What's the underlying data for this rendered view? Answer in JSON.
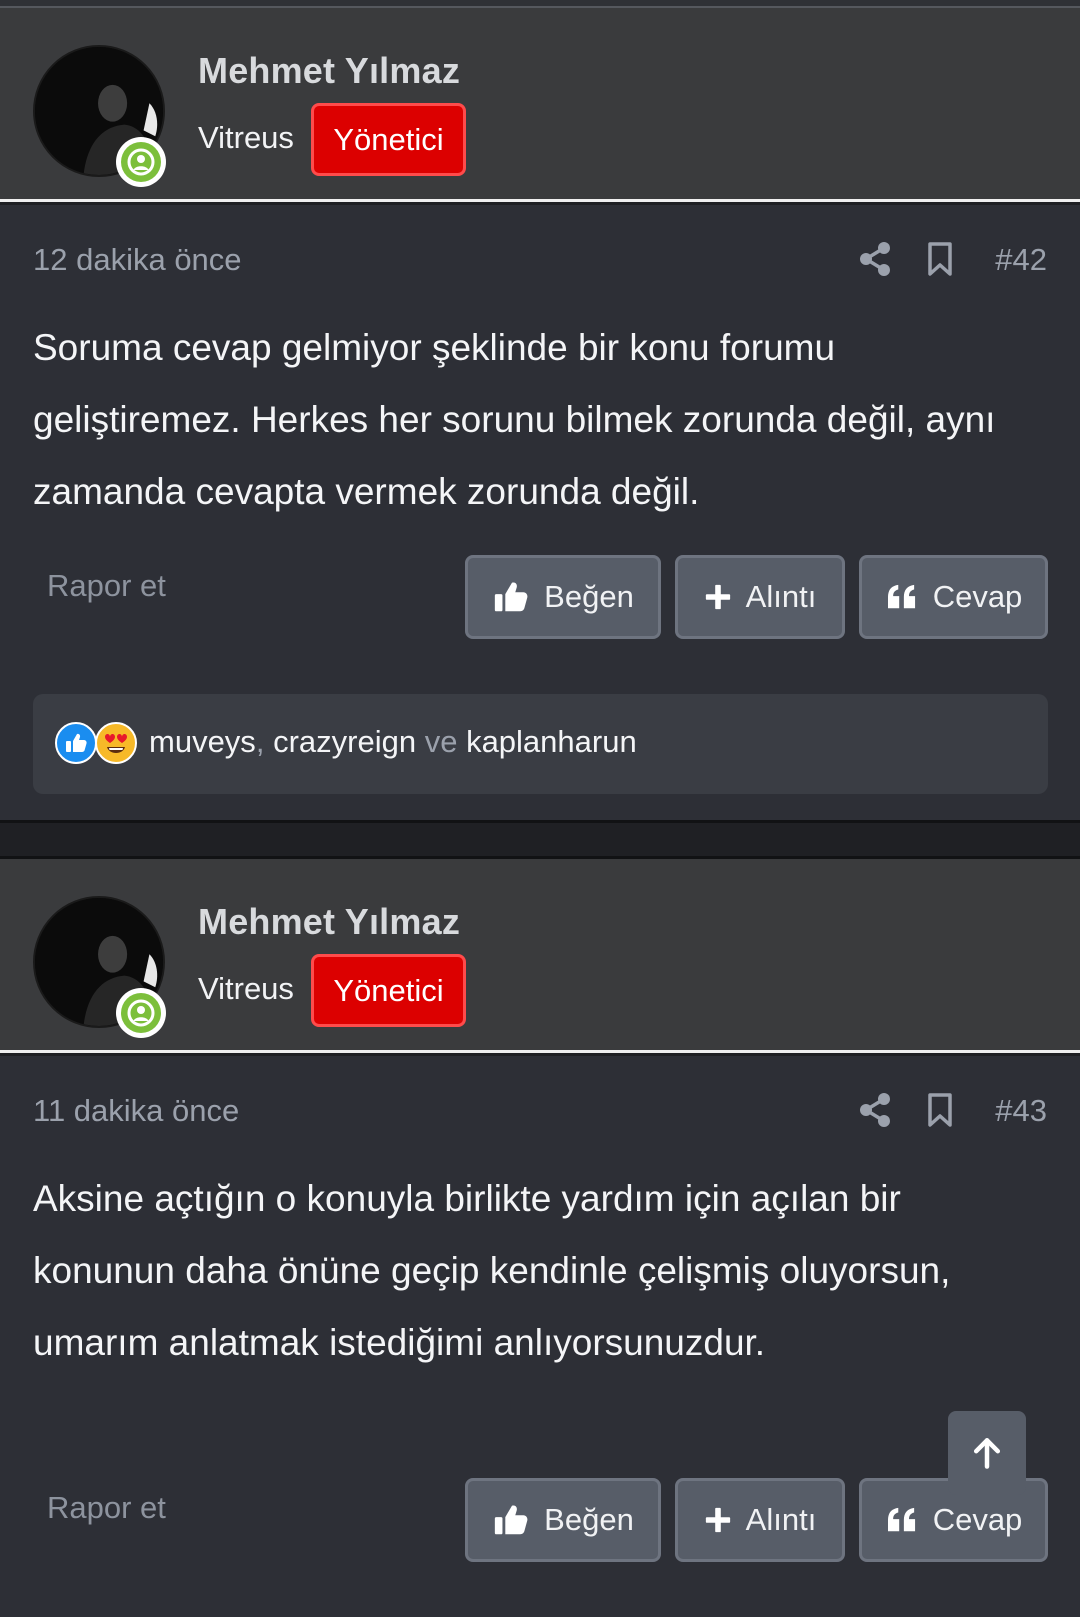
{
  "posts": [
    {
      "author": {
        "name": "Mehmet Yılmaz",
        "title": "Vitreus",
        "role": "Yönetici"
      },
      "time": "12 dakika önce",
      "number": "#42",
      "text": "Soruma cevap gelmiyor şeklinde bir konu forumu geliştiremez. Herkes her sorunu bilmek zorunda değil, aynı zamanda cevapta vermek zorunda değil.",
      "report_label": "Rapor et",
      "actions": {
        "like": "Beğen",
        "quote": "Alıntı",
        "reply": "Cevap"
      },
      "reactions": {
        "user1": "muveys",
        "comma": ",",
        "user2": "crazyreign",
        "and": "ve",
        "user3": "kaplanharun"
      }
    },
    {
      "author": {
        "name": "Mehmet Yılmaz",
        "title": "Vitreus",
        "role": "Yönetici"
      },
      "time": "11 dakika önce",
      "number": "#43",
      "text": "Aksine açtığın o konuyla birlikte yardım için açılan bir konunun daha önüne geçip kendinle çelişmiş oluyorsun, umarım anlatmak istediğimi anlıyorsunuzdur.",
      "report_label": "Rapor et",
      "actions": {
        "like": "Beğen",
        "quote": "Alıntı",
        "reply": "Cevap"
      }
    }
  ],
  "colors": {
    "header_bg": "#3a3b3d",
    "body_bg": "#2d2f36",
    "role_badge": "#dc0000",
    "online": "#7cbf3b",
    "button_bg": "#575d68"
  },
  "icons": [
    "share-icon",
    "bookmark-icon",
    "thumbs-up-icon",
    "plus-icon",
    "quote-icon",
    "arrow-up-icon",
    "user-online-icon"
  ]
}
